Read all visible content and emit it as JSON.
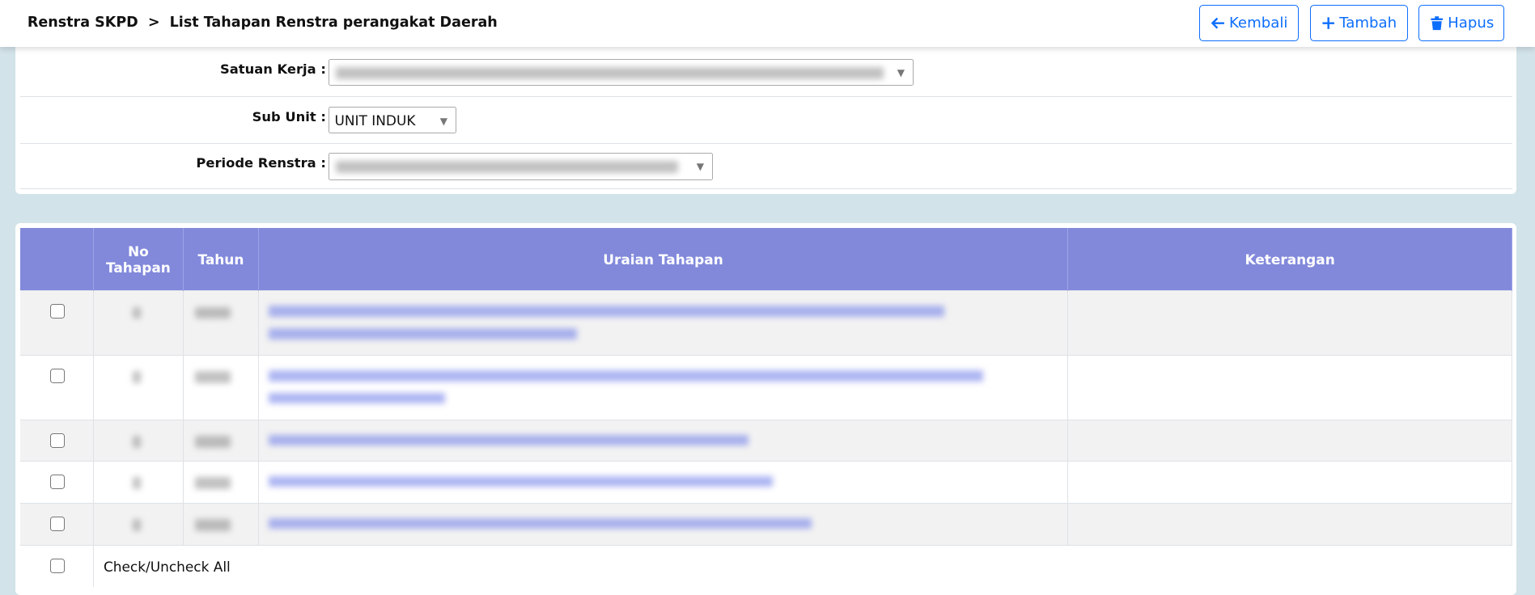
{
  "header": {
    "breadcrumb": [
      "Renstra SKPD",
      "List Tahapan Renstra perangakat Daerah"
    ],
    "separator": ">",
    "buttons": [
      {
        "label": "Kembali",
        "icon": "arrow-left-icon"
      },
      {
        "label": "Tambah",
        "icon": "plus-icon"
      },
      {
        "label": "Hapus",
        "icon": "trash-icon"
      }
    ]
  },
  "filters": {
    "satuan_kerja_label": "Satuan Kerja :",
    "sub_unit_label": "Sub Unit :",
    "sub_unit_value": "UNIT INDUK",
    "periode_label": "Periode Renstra :"
  },
  "table": {
    "headers": [
      "",
      "No Tahapan",
      "Tahun",
      "Uraian Tahapan",
      "Keterangan"
    ],
    "row_count": 5,
    "check_all_label": "Check/Uncheck All"
  },
  "colors": {
    "accent": "#0d6efd",
    "table_header": "#8289db",
    "background": "#d2e3e9"
  }
}
